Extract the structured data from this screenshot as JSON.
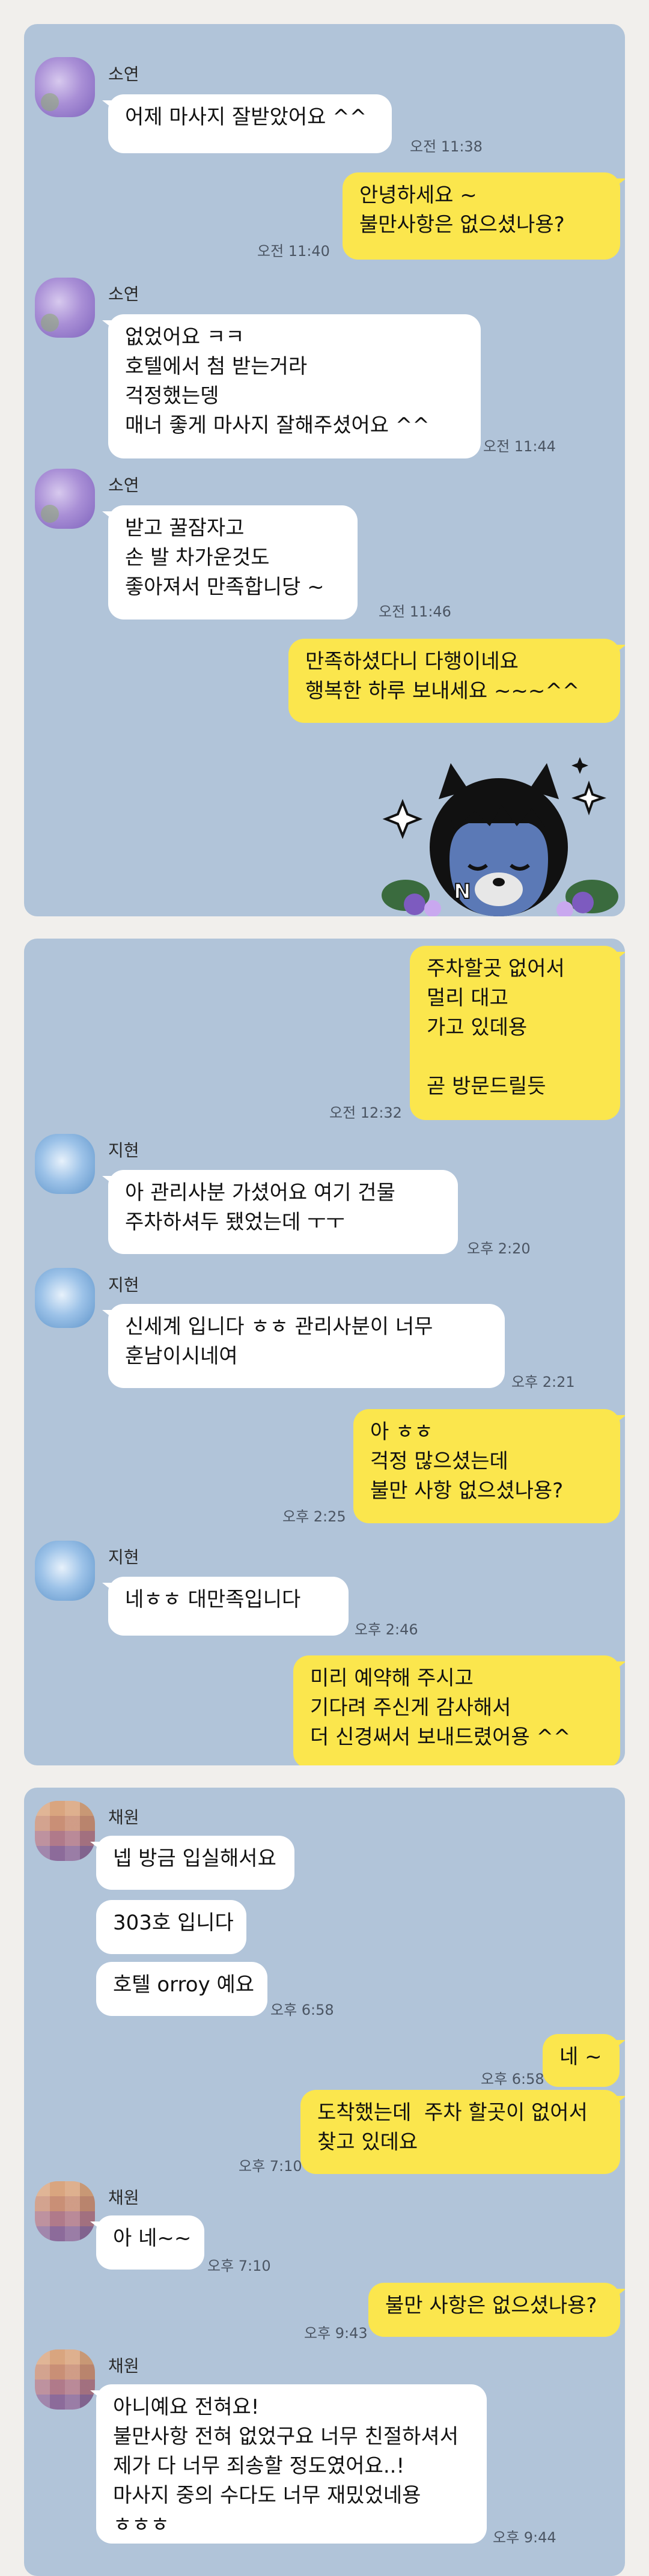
{
  "panel1": {
    "messages": [
      {
        "sender": "소연",
        "text": "어제 마사지 잘받았어요 ^^",
        "time": "오전 11:38"
      },
      {
        "sender": "",
        "text": "안녕하세요 ~\n불만사항은 없으셨나용?",
        "time": "오전 11:40"
      },
      {
        "sender": "소연",
        "text": "없었어요 ㅋㅋ\n호텔에서 첨 받는거라\n걱정했는뎅\n매너 좋게 마사지 잘해주셨어요 ^^",
        "time": "오전 11:44"
      },
      {
        "sender": "소연",
        "text": "받고 꿀잠자고\n손 발 차가운것도\n좋아져서 만족합니당 ~",
        "time": "오전 11:46"
      },
      {
        "sender": "",
        "text": "만족하셨다니 다행이네요\n행복한 하루 보내세요 ~~~^^",
        "time": ""
      }
    ],
    "sticker_icon": "kakao-friend-sticker-icon"
  },
  "panel2": {
    "messages": [
      {
        "sender": "",
        "text": "주차할곳 없어서\n멀리 대고\n가고 있데용\n\n곧 방문드릴듯",
        "time": "오전 12:32"
      },
      {
        "sender": "지현",
        "text": "아 관리사분 가셨어요 여기 건물\n주차하셔두 됐었는데 ㅜㅜ",
        "time": "오후 2:20"
      },
      {
        "sender": "지현",
        "text": "신세계 입니다 ㅎㅎ 관리사분이 너무\n훈남이시네여",
        "time": "오후 2:21"
      },
      {
        "sender": "",
        "text": "아 ㅎㅎ\n걱정 많으셨는데\n불만 사항 없으셨나용?",
        "time": "오후 2:25"
      },
      {
        "sender": "지현",
        "text": "네ㅎㅎ 대만족입니다",
        "time": "오후 2:46"
      },
      {
        "sender": "",
        "text": "미리 예약해 주시고\n기다려 주신게 감사해서\n더 신경써서 보내드렸어용 ^^",
        "time": ""
      }
    ]
  },
  "panel3": {
    "messages": [
      {
        "sender": "채원",
        "text": "넵 방금 입실해서요",
        "time": ""
      },
      {
        "sender": "",
        "text": "303호 입니다",
        "time": ""
      },
      {
        "sender": "",
        "text": "호텔 orroy 예요",
        "time": "오후 6:58"
      },
      {
        "sender": "",
        "text": "네 ~",
        "time": "오후 6:58"
      },
      {
        "sender": "",
        "text": "도착했는데  주차 할곳이 없어서\n찾고 있데요",
        "time": "오후 7:10"
      },
      {
        "sender": "채원",
        "text": "아 네~~",
        "time": "오후 7:10"
      },
      {
        "sender": "",
        "text": "불만 사항은 없으셨나용?",
        "time": "오후 9:43"
      },
      {
        "sender": "채원",
        "text": "아니예요 전혀요!\n불만사항 전혀 없었구요 너무 친절하셔서\n제가 다 너무 죄송할 정도였어요..!\n마사지 중의 수다도 너무 재밌었네용\nㅎㅎㅎ",
        "time": "오후 9:44"
      }
    ]
  }
}
